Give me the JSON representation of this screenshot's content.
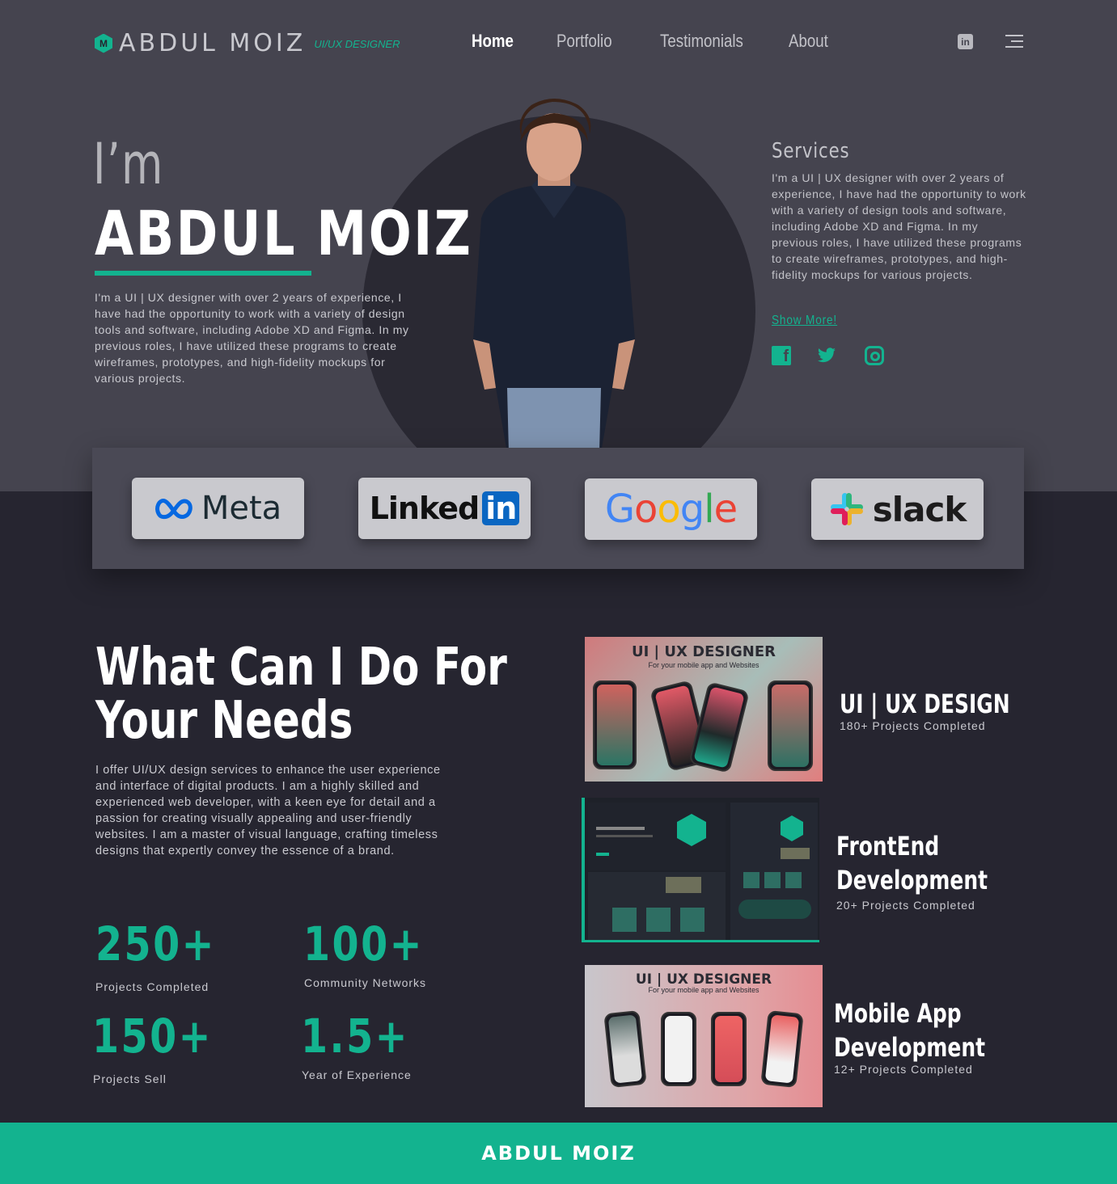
{
  "colors": {
    "accent": "#13b38f",
    "hero_bg": "#45444f",
    "page_bg": "#262530"
  },
  "header": {
    "logo_mark": "M",
    "logo_name": "ABDUL MOIZ",
    "logo_tagline": "UI/UX DESIGNER",
    "nav": [
      "Home",
      "Portfolio",
      "Testimonials",
      "About"
    ],
    "active_nav": "Home",
    "icons": [
      "linkedin-icon",
      "menu-icon"
    ]
  },
  "hero": {
    "greeting": "I’m",
    "name": "ABDUL MOIZ",
    "description": "I'm a UI | UX designer with over 2 years of experience, I have had the opportunity to work with a variety of design tools and software, including Adobe XD and Figma. In my previous roles, I have utilized these programs to create wireframes, prototypes, and high-fidelity mockups for various projects."
  },
  "services_intro": {
    "title": "Services",
    "description": "I'm a UI | UX designer with over 2 years of experience, I have had the opportunity to work with a variety of design tools and software, including Adobe XD and Figma. In my previous roles, I have utilized these programs to create wireframes, prototypes, and high-fidelity mockups for various projects.",
    "show_more": "Show More!",
    "social_icons": [
      "facebook-icon",
      "twitter-icon",
      "instagram-icon"
    ]
  },
  "partners": {
    "meta": "Meta",
    "linkedin_a": "Linked",
    "linkedin_b": "in",
    "slack": "slack"
  },
  "what": {
    "title_line1": "What Can I Do For",
    "title_line2": "Your Needs",
    "description": "I offer UI/UX design services to enhance the user experience and interface of digital products. I am a highly skilled and experienced web developer, with a keen eye for detail and a passion for creating visually appealing and user-friendly websites. I am a master of visual language, crafting timeless designs that expertly convey the essence of a brand."
  },
  "stats": [
    {
      "value": "250+",
      "label": "Projects Completed"
    },
    {
      "value": "100+",
      "label": "Community Networks"
    },
    {
      "value": "150+",
      "label": "Projects Sell"
    },
    {
      "value": "1.5+",
      "label": "Year of Experience"
    }
  ],
  "services": [
    {
      "title_line1": "UI | UX DESIGN",
      "title_line2": "",
      "subtitle": "180+ Projects Completed",
      "thumb_title": "UI | UX DESIGNER",
      "thumb_sub": "For your mobile app and Websites"
    },
    {
      "title_line1": "FrontEnd",
      "title_line2": "Development",
      "subtitle": "20+ Projects Completed"
    },
    {
      "title_line1": "Mobile App",
      "title_line2": "Development",
      "subtitle": "12+ Projects Completed",
      "thumb_title": "UI | UX DESIGNER",
      "thumb_sub": "For your mobile app and Websites"
    }
  ],
  "footer": {
    "text": "ABDUL MOIZ"
  }
}
